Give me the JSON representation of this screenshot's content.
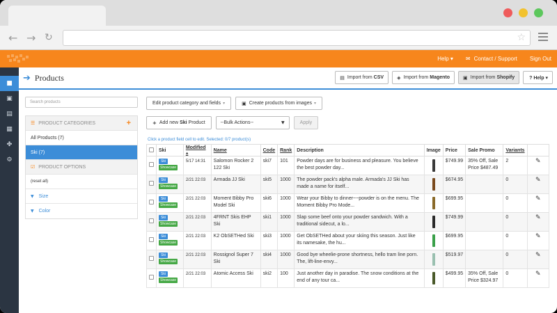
{
  "header": {
    "links": [
      "Help ▾",
      "Contact / Support",
      "Sign Out"
    ]
  },
  "page": {
    "title": "Products",
    "import_buttons": [
      {
        "prefix": "Import from",
        "bold": "CSV",
        "icon": "document-icon",
        "shaded": false
      },
      {
        "prefix": "Import from",
        "bold": "Magento",
        "icon": "magento-icon",
        "shaded": false
      },
      {
        "prefix": "Import from",
        "bold": "Shopify",
        "icon": "shopify-icon",
        "shaded": true
      }
    ],
    "help_button": "? Help ▾"
  },
  "sidebar": {
    "search_placeholder": "Search products",
    "categories_header": "PRODUCT CATEGORIES",
    "all_products": "All Products (7)",
    "ski": "Ski (7)",
    "options_header": "PRODUCT OPTIONS",
    "reset": "(reset all)",
    "options": [
      "Size",
      "Color"
    ]
  },
  "toolbar": {
    "edit_fields": "Edit product category and fields",
    "create_images": "Create products from images",
    "add_new_prefix": "Add new ",
    "add_new_bold": "Ski",
    "add_new_suffix": " Product",
    "bulk_actions": "--Bulk Actions--",
    "apply": "Apply",
    "hint": "Click a product field cell to edit. Selected: 0/7 product(s)"
  },
  "table": {
    "columns": [
      "",
      "Ski",
      "Modified ▴",
      "Name",
      "Code",
      "Rank",
      "Description",
      "Image",
      "Price",
      "Sale Promo",
      "Variants",
      ""
    ],
    "tag_ski": "Ski",
    "tag_showcase": "Showcase",
    "rows": [
      {
        "modified": "5/17 14:31",
        "name": "Salomon Rocker 2 122 Ski",
        "code": "ski7",
        "rank": "101",
        "description": "Powder days are for business and pleasure.  You believe the best powder day...",
        "price": "$749.99",
        "promo": "35% Off, Sale Price $487.49",
        "variants": "2",
        "img_color": "#3a3a3a"
      },
      {
        "modified": "2/21 22:03",
        "name": "Armada JJ Ski",
        "code": "ski5",
        "rank": "1000",
        "description": "The powder pack's alpha male.  Armada's JJ Ski has made a name for itself...",
        "price": "$674.95",
        "promo": "",
        "variants": "0",
        "img_color": "#7a4a1e"
      },
      {
        "modified": "2/21 22:03",
        "name": "Moment Bibby Pro Model Ski",
        "code": "ski6",
        "rank": "1000",
        "description": "Wear your Bibby to dinner~~powder is on the menu. The Moment Bibby Pro Mode...",
        "price": "$699.95",
        "promo": "",
        "variants": "0",
        "img_color": "#8a6a2a"
      },
      {
        "modified": "2/21 22:03",
        "name": "4FRNT Skis EHP Ski",
        "code": "ski1",
        "rank": "1000",
        "description": "Slap some beef onto your powder sandwich.  With a traditional sidecut, a lo...",
        "price": "$749.99",
        "promo": "",
        "variants": "0",
        "img_color": "#2a2a2a"
      },
      {
        "modified": "2/21 22:03",
        "name": "K2 ObSETHed Ski",
        "code": "ski3",
        "rank": "1000",
        "description": "Get ObSETHed about your skiing this season.  Just like its namesake, the hu...",
        "price": "$699.95",
        "promo": "",
        "variants": "0",
        "img_color": "#3aa04a"
      },
      {
        "modified": "2/21 22:03",
        "name": "Rossignol Super 7 Ski",
        "code": "ski4",
        "rank": "1000",
        "description": "Good bye wheelie-prone shortness, hello tram line porn. The, lift-line-envy...",
        "price": "$519.97",
        "promo": "",
        "variants": "0",
        "img_color": "#9ac0b0"
      },
      {
        "modified": "2/21 22:03",
        "name": "Atomic Access Ski",
        "code": "ski2",
        "rank": "100",
        "description": "Just another day in paradise. The snow conditions at the end of any tour ca...",
        "price": "$499.95",
        "promo": "35% Off, Sale Price $324.97",
        "variants": "0",
        "img_color": "#4a5a2a"
      }
    ]
  },
  "colors": {
    "brand_orange": "#f7861c",
    "accent_blue": "#3c8dd8",
    "rail_dark": "#2b3542",
    "showcase_green": "#45a845"
  }
}
